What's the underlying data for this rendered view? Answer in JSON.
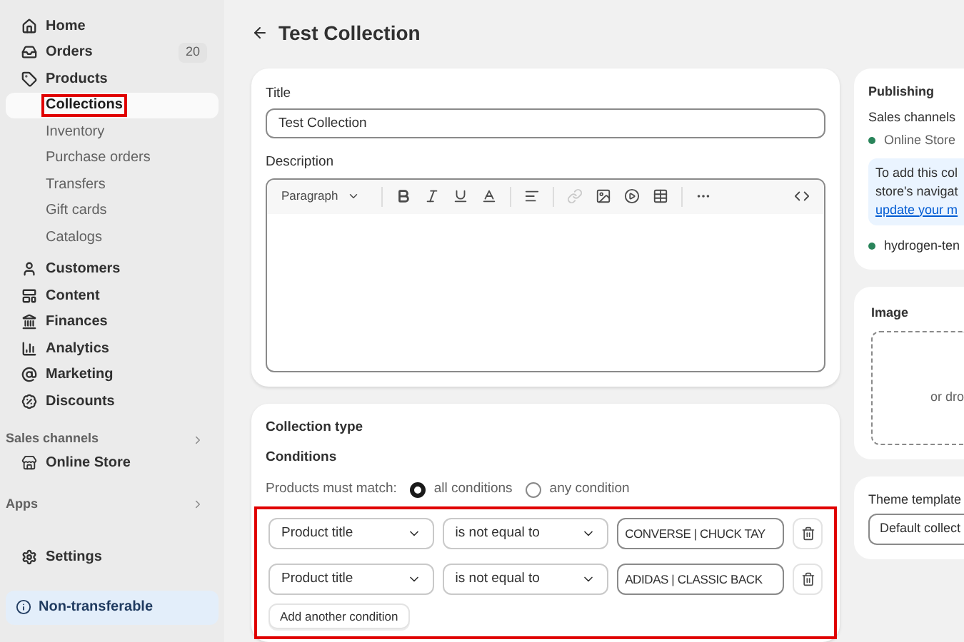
{
  "sidebar": {
    "items": [
      {
        "label": "Home",
        "kind": "main",
        "selected": false
      },
      {
        "label": "Orders",
        "kind": "main",
        "selected": false,
        "count": "20"
      },
      {
        "label": "Products",
        "kind": "main",
        "selected": false
      },
      {
        "label": "Collections",
        "kind": "sub",
        "selected": true,
        "highlighted": true
      },
      {
        "label": "Inventory",
        "kind": "sub",
        "selected": false
      },
      {
        "label": "Purchase orders",
        "kind": "sub",
        "selected": false
      },
      {
        "label": "Transfers",
        "kind": "sub",
        "selected": false
      },
      {
        "label": "Gift cards",
        "kind": "sub",
        "selected": false
      },
      {
        "label": "Catalogs",
        "kind": "sub",
        "selected": false
      },
      {
        "label": "Customers",
        "kind": "main",
        "selected": false
      },
      {
        "label": "Content",
        "kind": "main",
        "selected": false
      },
      {
        "label": "Finances",
        "kind": "main",
        "selected": false
      },
      {
        "label": "Analytics",
        "kind": "main",
        "selected": false
      },
      {
        "label": "Marketing",
        "kind": "main",
        "selected": false
      },
      {
        "label": "Discounts",
        "kind": "main",
        "selected": false
      }
    ],
    "sales_channels": {
      "heading": "Sales channels",
      "items": [
        {
          "label": "Online Store",
          "selected": false
        }
      ]
    },
    "apps": {
      "heading": "Apps"
    },
    "settings": "Settings",
    "notice": "Non-transferable"
  },
  "page": {
    "title": "Test Collection"
  },
  "details": {
    "title_label": "Title",
    "title_value": "Test Collection",
    "description_label": "Description",
    "format": "Paragraph"
  },
  "collection_type": {
    "heading": "Collection type",
    "conditions_label": "Conditions",
    "match_label": "Products must match:",
    "match_options": [
      {
        "label": "all conditions",
        "selected": true
      },
      {
        "label": "any condition",
        "selected": false
      }
    ],
    "conditions": [
      {
        "field": "Product title",
        "operator": "is not equal to",
        "value": "CONVERSE | CHUCK TAY"
      },
      {
        "field": "Product title",
        "operator": "is not equal to",
        "value": "ADIDAS | CLASSIC BACK"
      }
    ],
    "add_button": "Add another condition",
    "highlighted": true
  },
  "publishing": {
    "heading": "Publishing",
    "channels_label": "Sales channels",
    "channels": [
      {
        "name": "Online Store",
        "color": "#29845a"
      }
    ],
    "notice_lines": [
      "To add this col",
      "store's navigat"
    ],
    "notice_link": "update your m",
    "extra_channels": [
      {
        "name": "hydrogen-ten",
        "color": "#29845a"
      }
    ]
  },
  "image": {
    "heading": "Image",
    "drop_text": "or dro"
  },
  "theme_template": {
    "label": "Theme template",
    "value": "Default collect"
  }
}
